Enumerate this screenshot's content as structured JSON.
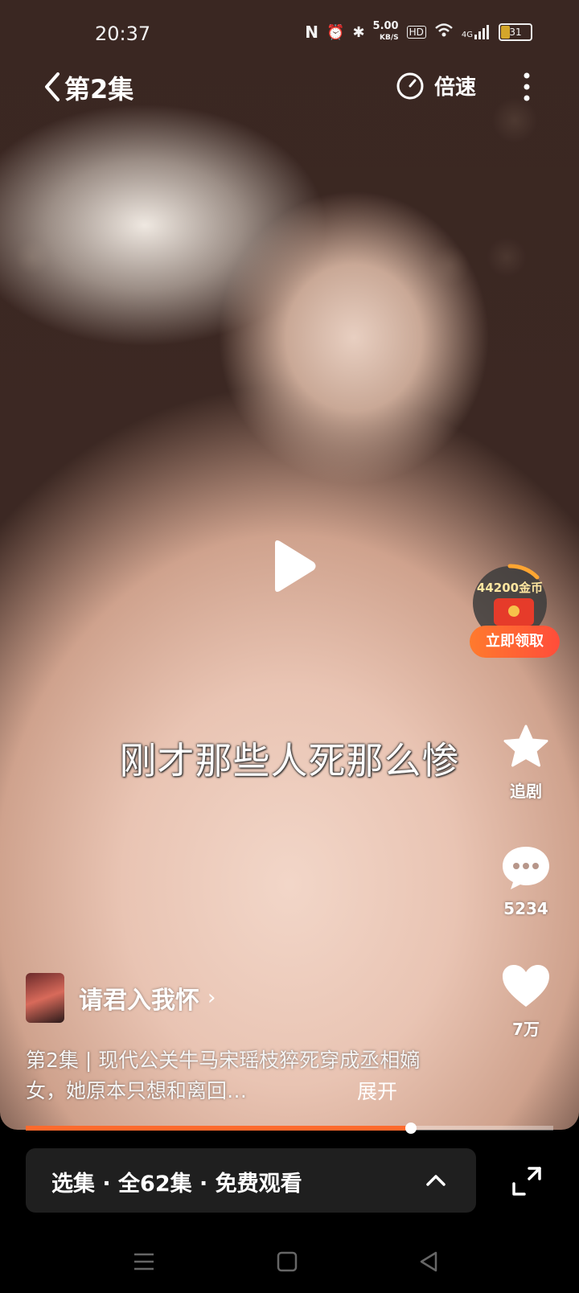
{
  "status_bar": {
    "time": "20:37",
    "net_speed_value": "5.00",
    "net_speed_unit": "KB/S",
    "hd_badge": "HD",
    "network": "4G",
    "battery": "31"
  },
  "header": {
    "episode_title": "第2集",
    "speed_label": "倍速"
  },
  "video": {
    "subtitle": "刚才那些人死那么惨",
    "progress": 0.73
  },
  "reward": {
    "coins_label": "44200金币",
    "claim_label": "立即领取"
  },
  "actions": {
    "follow_label": "追剧",
    "comments_count": "5234",
    "likes_count": "7万"
  },
  "drama": {
    "name": "请君入我怀",
    "description": "第2集 | 现代公关牛马宋瑶枝猝死穿成丞相嫡女，她原本只想和离回…",
    "expand_label": "展开"
  },
  "episodes_bar": {
    "label": "选集 · 全62集 · 免费观看"
  },
  "colors": {
    "accent": "#ff6a2d",
    "panel": "#1f1f1f"
  }
}
